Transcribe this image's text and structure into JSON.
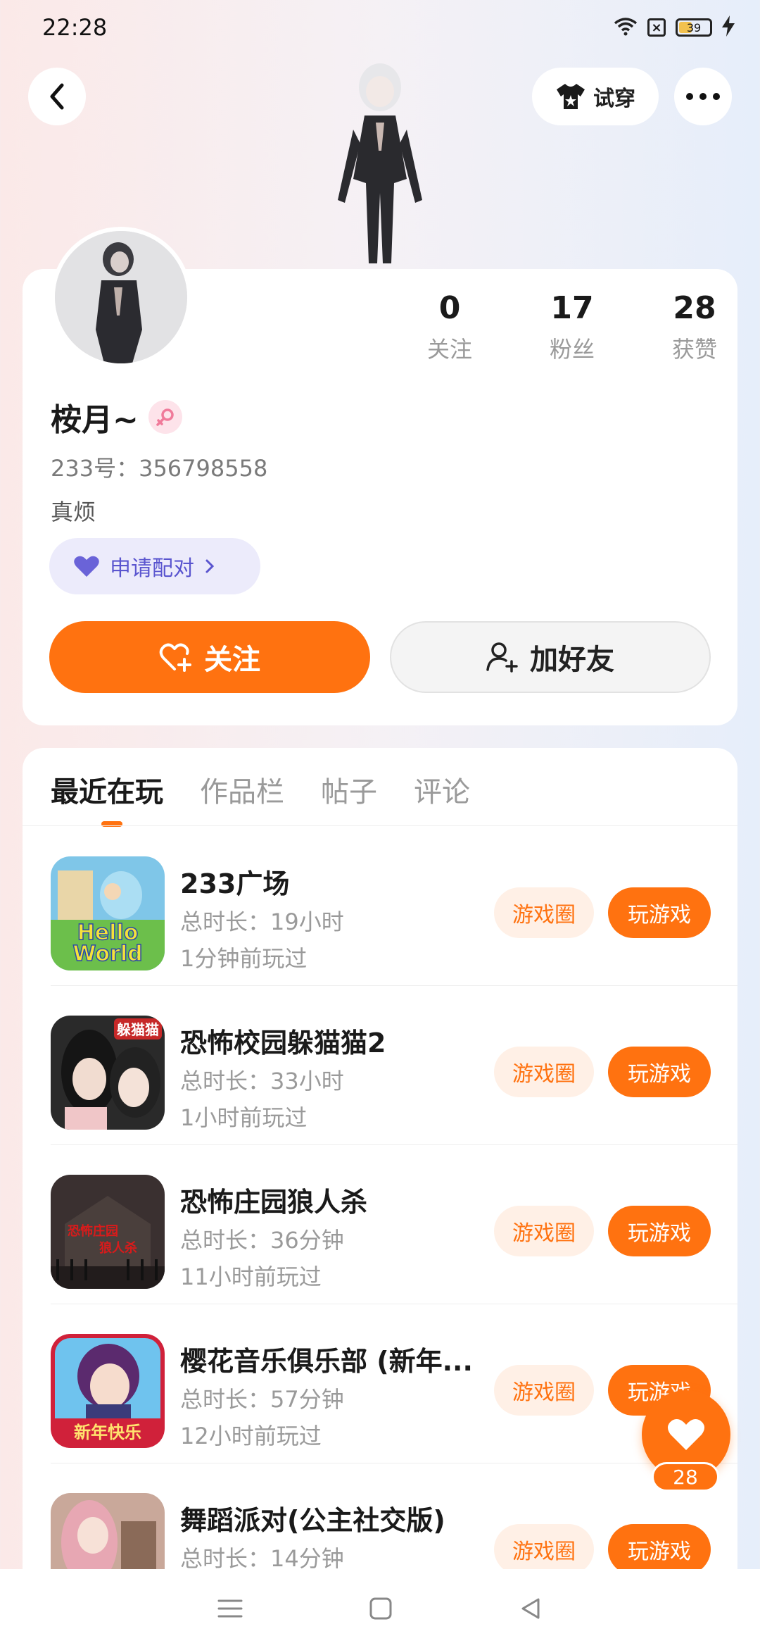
{
  "status_bar": {
    "time": "22:28",
    "battery": "39"
  },
  "header": {
    "try_on_label": "试穿"
  },
  "profile": {
    "stats": [
      {
        "value": "0",
        "label": "关注"
      },
      {
        "value": "17",
        "label": "粉丝"
      },
      {
        "value": "28",
        "label": "获赞"
      }
    ],
    "name": "桉月~",
    "uid": "233号：356798558",
    "bio": "真烦",
    "match_label": "申请配对",
    "follow_label": "关注",
    "add_friend_label": "加好友"
  },
  "tabs": [
    {
      "label": "最近在玩"
    },
    {
      "label": "作品栏"
    },
    {
      "label": "帖子"
    },
    {
      "label": "评论"
    }
  ],
  "games": [
    {
      "title": "233广场",
      "duration": "总时长：19小时",
      "last_played": "1分钟前玩过",
      "circle": "游戏圈",
      "play": "玩游戏",
      "icon_text": "Hello World"
    },
    {
      "title": "恐怖校园躲猫猫2",
      "duration": "总时长：33小时",
      "last_played": "1小时前玩过",
      "circle": "游戏圈",
      "play": "玩游戏",
      "icon_text": "躲猫猫"
    },
    {
      "title": "恐怖庄园狼人杀",
      "duration": "总时长：36分钟",
      "last_played": "11小时前玩过",
      "circle": "游戏圈",
      "play": "玩游戏",
      "icon_text": "恐怖庄园 狼人杀"
    },
    {
      "title": "樱花音乐俱乐部 (新年...",
      "duration": "总时长：57分钟",
      "last_played": "12小时前玩过",
      "circle": "游戏圈",
      "play": "玩游戏",
      "icon_text": "新年快乐"
    },
    {
      "title": "舞蹈派对(公主社交版)",
      "duration": "总时长：14分钟",
      "last_played": "",
      "circle": "游戏圈",
      "play": "玩游戏",
      "icon_text": ""
    }
  ],
  "like_fab": {
    "count": "28"
  },
  "colors": {
    "accent": "#ff7210",
    "match_bg": "#ecebfb",
    "match_text": "#5a55cf"
  }
}
